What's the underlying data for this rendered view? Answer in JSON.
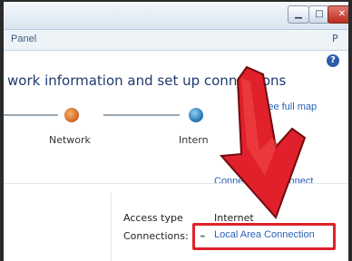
{
  "window": {
    "title_buttons": {
      "minimize": "▁",
      "maximize": "□",
      "close": "✕"
    }
  },
  "address": {
    "crumb": "Panel",
    "right": "P"
  },
  "help": {
    "label": "?"
  },
  "heading": "work information and set up connections",
  "map": {
    "network_label": "Network",
    "internet_label": "Intern",
    "see_full_map": "See full map",
    "connect_link": "Connect or disconnect",
    "connect_visible": "Conne"
  },
  "details": {
    "access_type_label": "Access type",
    "access_type_value": "Internet",
    "connections_label": "Connections:",
    "connection_value": "Local Area Connection"
  },
  "icons": {
    "help": "help-icon",
    "network": "network-icon",
    "globe": "globe-icon",
    "connection": "ethernet-icon",
    "arrow": "red-arrow-annotation"
  },
  "colors": {
    "annotation": "#e0202a",
    "link": "#2a62b8",
    "heading": "#1e3a6e"
  }
}
